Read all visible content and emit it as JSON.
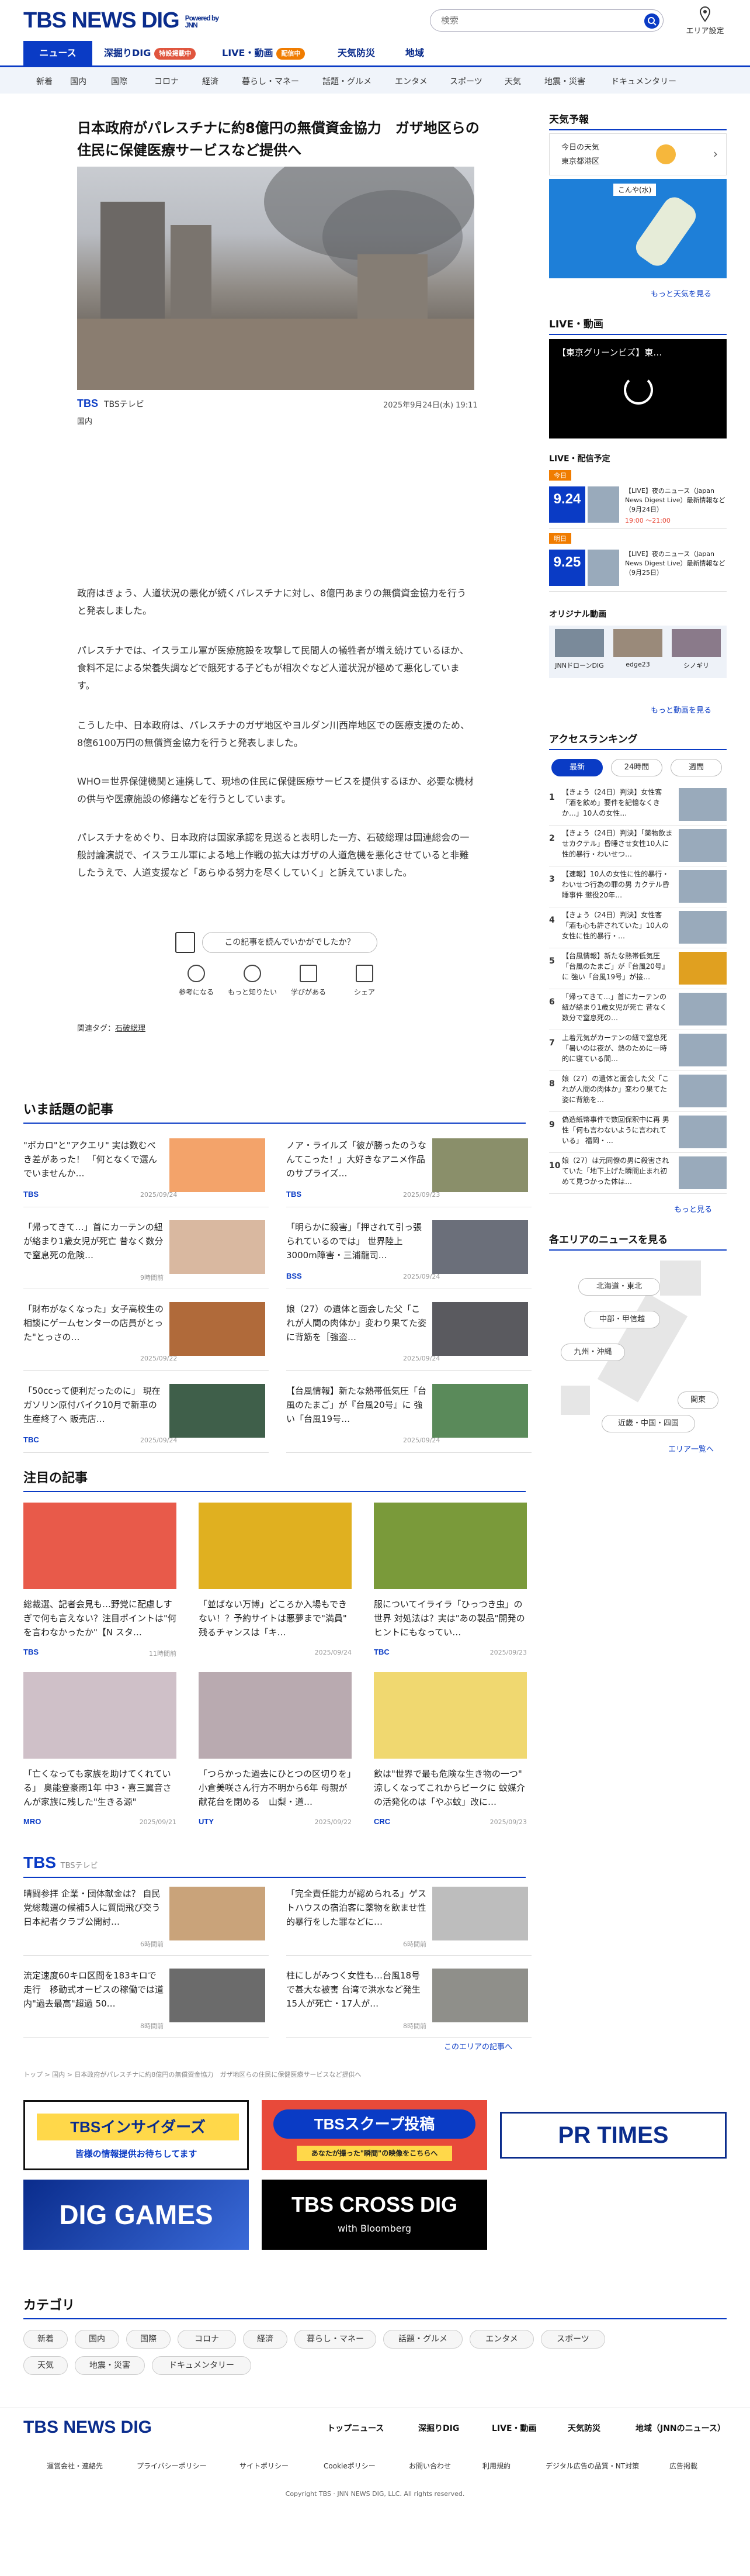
{
  "header": {
    "logo": "TBS NEWS DIG",
    "powered": "Powered by JNN",
    "search_placeholder": "検索",
    "area_label": "エリア設定"
  },
  "tabs": [
    {
      "label": "ニュース"
    },
    {
      "label": "深掘りDIG",
      "badge": "特設掲載中"
    },
    {
      "label": "LIVE・動画",
      "badge": "配信中"
    },
    {
      "label": "天気防災"
    },
    {
      "label": "地域"
    }
  ],
  "subnav": [
    "新着",
    "国内",
    "国際",
    "コロナ",
    "経済",
    "暮らし・マネー",
    "話題・グルメ",
    "エンタメ",
    "スポーツ",
    "天気",
    "地震・災害",
    "ドキュメンタリー"
  ],
  "article": {
    "title": "日本政府がパレスチナに約8億円の無償資金協力　ガザ地区らの住民に保健医療サービスなど提供へ",
    "source": "TBS",
    "source_name": "TBSテレビ",
    "date": "2025年9月24日(水) 19:11",
    "category": "国内",
    "paragraphs": [
      "政府はきょう、人道状況の悪化が続くパレスチナに対し、8億円あまりの無償資金協力を行うと発表しました。",
      "パレスチナでは、イスラエル軍が医療施設を攻撃して民間人の犠牲者が増え続けているほか、食料不足による栄養失調などで餓死する子どもが相次ぐなど人道状況が極めて悪化しています。",
      "こうした中、日本政府は、パレスチナのガザ地区やヨルダン川西岸地区での医療支援のため、8億6100万円の無償資金協力を行うと発表しました。",
      "WHO＝世界保健機関と連携して、現地の住民に保健医療サービスを提供するほか、必要な機材の供与や医療施設の修繕などを行うとしています。",
      "パレスチナをめぐり、日本政府は国家承認を見送ると表明した一方、石破総理は国連総会の一般討論演説で、イスラエル軍による地上作戦の拡大はガザの人道危機を悪化させていると非難したうえで、人道支援など「あらゆる努力を尽くしていく」と訴えていました。"
    ],
    "feedback": "この記事を読んでいかがでしたか？",
    "reactions": [
      "参考になる",
      "もっと知りたい",
      "学びがある",
      "シェア"
    ],
    "tags_label": "関連タグ：",
    "tag": "石破総理"
  },
  "trending": {
    "title": "いま話題の記事",
    "items": [
      {
        "t": "\"ボカロ\"と\"アクエリ\" 実は数むべき差があった！ 「何となくで選んでいませんか…",
        "s": "TBS",
        "d": "2025/09/24"
      },
      {
        "t": "ノア・ライルズ「彼が勝ったのうなんてこった！」大好きなアニメ作品のサプライズ…",
        "s": "TBS",
        "d": "2025/09/23"
      },
      {
        "t": "「帰ってきて…」首にカーテンの紐が絡まり1歳女児が死亡 昔なく数分で窒息死の危険…",
        "s": "",
        "d": "9時間前"
      },
      {
        "t": "「明らかに殺害」「押されて引っ張られているのでは」 世界陸上3000m障害・三浦龍司…",
        "s": "BSS",
        "d": "2025/09/24"
      },
      {
        "t": "「財布がなくなった」女子高校生の相談にゲームセンターの店員がとった\"とっさの…",
        "s": "",
        "d": "2025/09/22"
      },
      {
        "t": "娘（27）の遺体と面会した父「これが人間の肉体か」変わり果てた姿に背筋を［強盗…",
        "s": "",
        "d": "2025/09/24"
      },
      {
        "t": "「50ccって便利だったのに」 現在ガソリン原付バイク10月で新車の生産終了へ 販売店…",
        "s": "TBC",
        "d": "2025/09/24"
      },
      {
        "t": "【台風情報】新たな熱帯低気圧「台風のたまご」が『台風20号』に 強い「台風19号…",
        "s": "",
        "d": "2025/09/24"
      }
    ]
  },
  "featured": {
    "title": "注目の記事",
    "items": [
      {
        "t": "総裁選、記者会見も…野党に配慮しすぎで何も言えない？注目ポイントは\"何を言わなかったか\"【N スタ…",
        "s": "TBS",
        "d": "11時間前"
      },
      {
        "t": "「並ばない万博」どころか入場もできない！？予約サイトは悪夢まで\"満員\" 残るチャンスは「キ…",
        "s": "",
        "d": "2025/09/24"
      },
      {
        "t": "服についてイライラ「ひっつき虫」の世界 対処法は？実は\"あの製品\"開発のヒントにもなってい…",
        "s": "TBC",
        "d": "2025/09/23"
      },
      {
        "t": "「亡くなっても家族を助けてくれている」 奥能登豪雨1年 中3・喜三翼音さんが家族に残した\"生きる源\"",
        "s": "MRO",
        "d": "2025/09/21"
      },
      {
        "t": "「つらかった過去にひとつの区切りを」小倉美咲さん行方不明から6年 母親が献花台を閉める　山梨・道…",
        "s": "UTY",
        "d": "2025/09/22"
      },
      {
        "t": "飲は\"世界で最も危険な生き物の一つ\" 涼しくなってこれからピークに 蚊媒介の活発化のは「やぶ蚊」改に…",
        "s": "CRC",
        "d": "2025/09/23"
      }
    ]
  },
  "tbs_block": {
    "title": "TBS",
    "sub": "TBSテレビ",
    "items": [
      {
        "t": "晴闘参拝 企業・団体献金は？ 自民党総裁選の候補5人に質問飛び交う　日本記者クラブ公開討…",
        "d": "6時間前"
      },
      {
        "t": "「完全責任能力が認められる」ゲストハウスの宿泊客に薬物を飲ませ性的暴行をした罪などに…",
        "d": "6時間前"
      },
      {
        "t": "流定速度60キロ区間を183キロで走行　移動式オービスの稼働では道内\"過去最高\"超過 50…",
        "d": "8時間前"
      },
      {
        "t": "柱にしがみつく女性も…台風18号で甚大な被害 台湾で洪水など発生　15人が死亡・17人が…",
        "d": "8時間前"
      }
    ],
    "more": "このエリアの記事へ"
  },
  "breadcrumb": "トップ > 国内 > 日本政府がパレスチナに約8億円の無償資金協力　ガザ地区らの住民に保健医療サービスなど提供へ",
  "banners": [
    "TBSインサイダーズ",
    "皆様の情報提供お待ちしてます",
    "TBSスクープ投稿",
    "あなたが撮った\"瞬間\"の映像をこちらへ",
    "PR TIMES",
    "DIG GAMES",
    "TBS CROSS DIG",
    "with Bloomberg"
  ],
  "categories": {
    "title": "カテゴリ",
    "items": [
      "新着",
      "国内",
      "国際",
      "コロナ",
      "経済",
      "暮らし・マネー",
      "話題・グルメ",
      "エンタメ",
      "スポーツ",
      "天気",
      "地震・災害",
      "ドキュメンタリー"
    ]
  },
  "sidebar": {
    "weather": {
      "title": "天気予報",
      "today": "今日の天気",
      "region": "東京都港区",
      "map_label": "こんや(水)",
      "more": "もっと天気を見る"
    },
    "live": {
      "title": "LIVE・動画",
      "video_title": "【東京グリーンビズ】東…"
    },
    "schedule": {
      "title": "LIVE・配信予定",
      "items": [
        {
          "tag": "今日",
          "date": "9.24",
          "day": "水",
          "t": "【LIVE】夜のニュース（Japan News Digest Live）最新情報など（9月24日）",
          "time": "19:00 ～21:00",
          "badge": "LIVE"
        },
        {
          "tag": "明日",
          "date": "9.25",
          "day": "木",
          "t": "【LIVE】夜のニュース（Japan News Digest Live）最新情報など（9月25日）",
          "time": ""
        }
      ]
    },
    "original": {
      "title": "オリジナル動画",
      "items": [
        "JNNドローンDIG",
        "edge23",
        "シノギリ"
      ],
      "more": "もっと動画を見る"
    },
    "ranking": {
      "title": "アクセスランキング",
      "tabs": [
        "最新",
        "24時間",
        "週間"
      ],
      "items": [
        "【きょう（24日）判決】女性客「酒を飲め」要件を記憶なくきか…」10人の女性…",
        "【きょう（24日）判決】「薬物飲ませカクテル」昏睡させ女性10人に性的暴行・わいせつ…",
        "【速報】10人の女性に性的暴行・わいせつ行為の罪の男 カクテル昏睡事件 懲役20年…",
        "【きょう（24日）判決】女性客「酒も心も許されていた」10人の女性に性的暴行・…",
        "【台風情報】新たな熱帯低気圧「台風のたまご」が『台風20号』に 強い「台風19号」が接…",
        "「帰ってきて…」首にカーテンの紐が絡まり1歳女児が死亡 昔なく数分で窒息死の…",
        "上着元気がカーテンの紐で窒息死「暑いのは夜が、熱のために一時的に寝ている間…",
        "娘（27）の遺体と面会した父「これが人間の肉体か」変わり果てた姿に背筋を…",
        "偽造紙幣事件で数回保釈中に再 男性「何も言わないように言われている」 福岡・…",
        "娘（27）は元同僚の男に殺害されていた「地下上げた瞬間止まれ初めて見つかった体は…"
      ],
      "more": "もっと見る"
    },
    "areas": {
      "title": "各エリアのニュースを見る",
      "items": [
        "北海道・東北",
        "中部・甲信越",
        "九州・沖縄",
        "関東",
        "近畿・中国・四国"
      ],
      "more": "エリア一覧へ"
    }
  },
  "footer": {
    "logo": "TBS NEWS DIG",
    "links": [
      "トップニュース",
      "深掘りDIG",
      "LIVE・動画",
      "天気防災",
      "地域（JNNのニュース）"
    ],
    "sub": [
      "運営会社・連絡先",
      "プライバシーポリシー",
      "サイトポリシー",
      "Cookieポリシー",
      "お問い合わせ",
      "利用規約",
      "デジタル広告の品質・NT対策",
      "広告掲載"
    ],
    "copyright": "Copyright TBS · JNN NEWS DIG, LLC. All rights reserved."
  }
}
